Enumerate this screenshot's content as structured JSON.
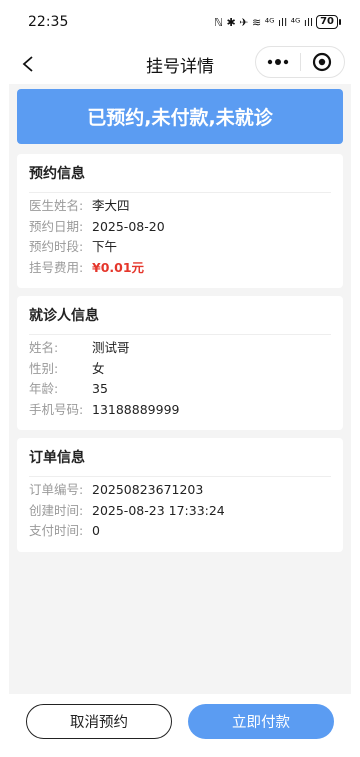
{
  "status_bar": {
    "time": "22:35",
    "icons_text": "ℕ ✱ ✈ ≋ ⁴ᴳ ıll ⁴ᴳ ıll",
    "battery": "70"
  },
  "nav": {
    "title": "挂号详情",
    "back_icon": "chevron-left-icon",
    "more_icon": "more-dots-icon",
    "close_icon": "target-circle-icon"
  },
  "banner": {
    "text": "已预约,未付款,未就诊",
    "color": "#5b9cf2"
  },
  "appointment": {
    "title": "预约信息",
    "rows": [
      {
        "label": "医生姓名:",
        "value": "李大四"
      },
      {
        "label": "预约日期:",
        "value": "2025-08-20"
      },
      {
        "label": "预约时段:",
        "value": "下午"
      },
      {
        "label": "挂号费用:",
        "value": "¥0.01元"
      }
    ]
  },
  "patient": {
    "title": "就诊人信息",
    "rows": [
      {
        "label": "姓名:",
        "value": "测试哥"
      },
      {
        "label": "性别:",
        "value": "女"
      },
      {
        "label": "年龄:",
        "value": "35"
      },
      {
        "label": "手机号码:",
        "value": "13188889999"
      }
    ]
  },
  "order": {
    "title": "订单信息",
    "rows": [
      {
        "label": "订单编号:",
        "value": "20250823671203"
      },
      {
        "label": "创建时间:",
        "value": "2025-08-23 17:33:24"
      },
      {
        "label": "支付时间:",
        "value": "0"
      }
    ]
  },
  "actions": {
    "cancel_label": "取消预约",
    "pay_label": "立即付款",
    "price_color": "#e5362b"
  }
}
